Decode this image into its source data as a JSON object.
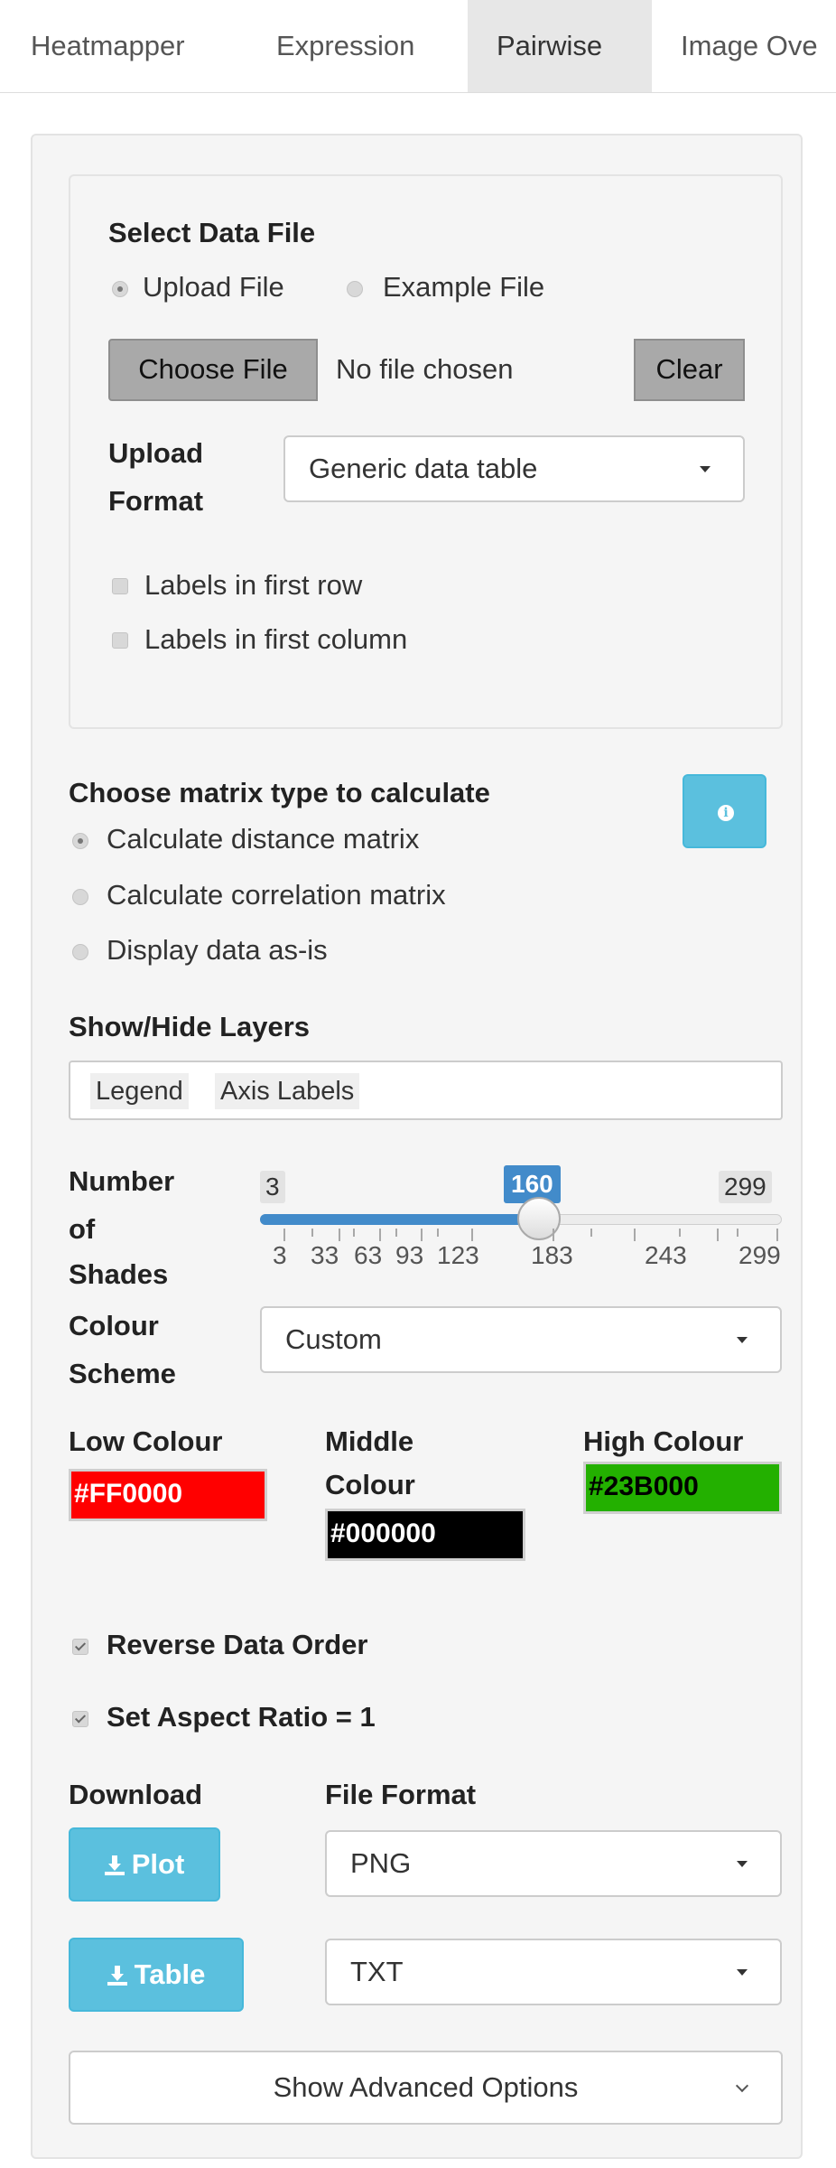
{
  "tabs": [
    {
      "label": "Heatmapper",
      "active": false
    },
    {
      "label": "Expression",
      "active": false
    },
    {
      "label": "Pairwise",
      "active": true
    },
    {
      "label": "Image Ove",
      "active": false
    }
  ],
  "data_file": {
    "heading": "Select Data File",
    "source_options": [
      "Upload File",
      "Example File"
    ],
    "selected_source": "Upload File",
    "choose_file_label": "Choose File",
    "file_status": "No file chosen",
    "clear_label": "Clear",
    "upload_format_label_line1": "Upload",
    "upload_format_label_line2": "Format",
    "upload_format_value": "Generic data table",
    "checkboxes": [
      {
        "label": "Labels in first row",
        "checked": false
      },
      {
        "label": "Labels in first column",
        "checked": false
      }
    ]
  },
  "matrix": {
    "heading": "Choose matrix type to calculate",
    "info_icon": "info-icon",
    "options": [
      {
        "label": "Calculate distance matrix",
        "selected": true
      },
      {
        "label": "Calculate correlation matrix",
        "selected": false
      },
      {
        "label": "Display data as-is",
        "selected": false
      }
    ]
  },
  "layers": {
    "heading": "Show/Hide Layers",
    "tags": [
      "Legend",
      "Axis Labels"
    ]
  },
  "shades": {
    "label_line1": "Number",
    "label_line2": "of",
    "label_line3": "Shades",
    "min": "3",
    "max": "299",
    "value": "160",
    "value_fraction": 0.53,
    "tick_labels": [
      "3",
      "33",
      "63",
      "93",
      "123",
      "183",
      "243",
      "299"
    ]
  },
  "colour_scheme": {
    "label_line1": "Colour",
    "label_line2": "Scheme",
    "value": "Custom"
  },
  "colours": {
    "low_label": "Low Colour",
    "low_value": "#FF0000",
    "middle_label_line1": "Middle",
    "middle_label_line2": "Colour",
    "middle_value": "#000000",
    "high_label": "High Colour",
    "high_value": "#23B000"
  },
  "options": {
    "reverse_label": "Reverse Data Order",
    "reverse_checked": true,
    "aspect_label": "Set Aspect Ratio = 1",
    "aspect_checked": true
  },
  "download": {
    "heading": "Download",
    "file_format_heading": "File Format",
    "plot_button": "Plot",
    "table_button": "Table",
    "plot_format": "PNG",
    "table_format": "TXT",
    "icon": "download-icon"
  },
  "advanced_button": "Show Advanced Options",
  "accent_color": "#5bc0de",
  "slider_color": "#428bca"
}
